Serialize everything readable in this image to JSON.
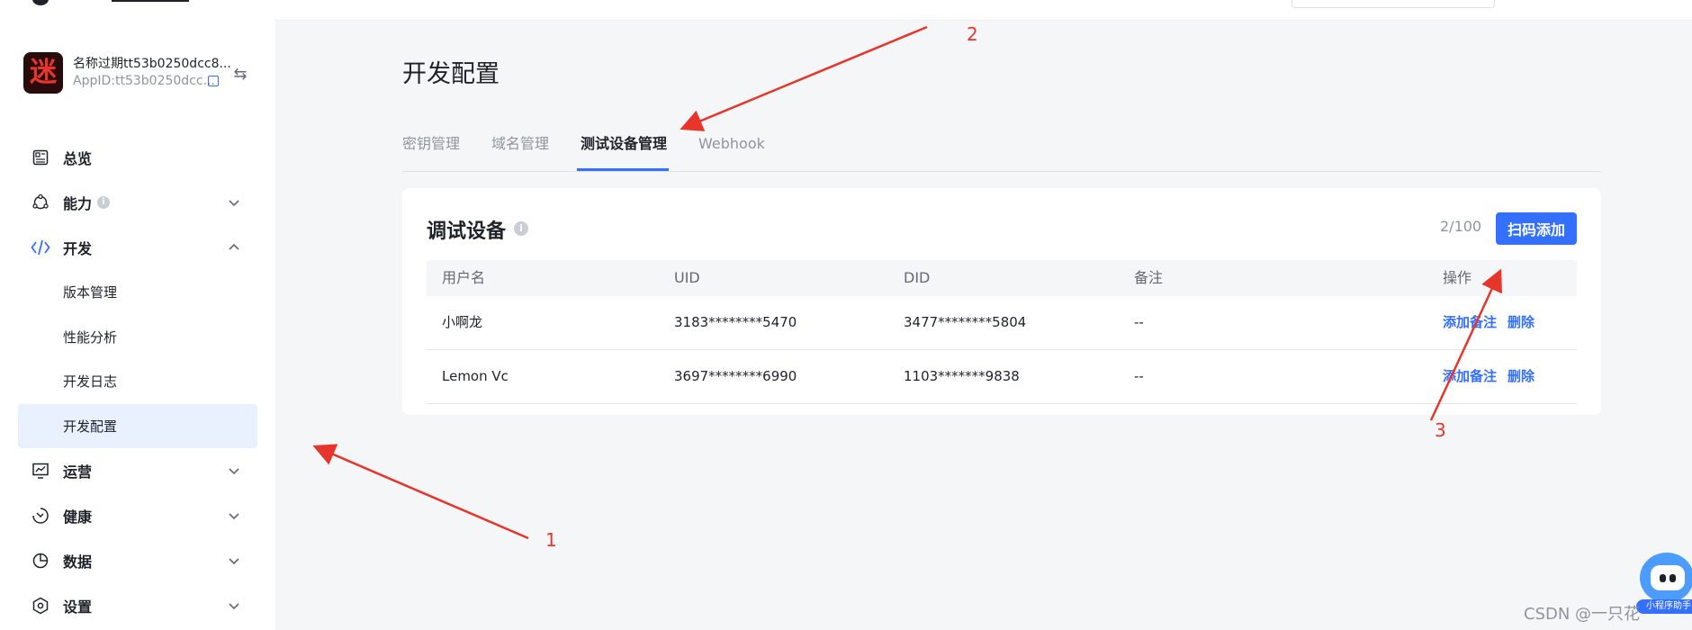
{
  "app": {
    "name": "名称过期tt53b0250dcc8...",
    "app_id": "AppID:tt53b0250dcc...",
    "avatar_glyph": "迷"
  },
  "sidebar": {
    "items": [
      {
        "label": "总览",
        "icon": "overview-icon"
      },
      {
        "label": "能力",
        "icon": "capability-icon",
        "info": "i",
        "expanded": false
      },
      {
        "label": "开发",
        "icon": "code-icon",
        "expanded": true
      },
      {
        "label": "运营",
        "icon": "operation-icon",
        "expanded": false
      },
      {
        "label": "健康",
        "icon": "health-icon",
        "expanded": false
      },
      {
        "label": "数据",
        "icon": "data-icon",
        "expanded": false
      },
      {
        "label": "设置",
        "icon": "settings-icon",
        "expanded": false
      }
    ],
    "dev_sub": [
      "版本管理",
      "性能分析",
      "开发日志",
      "开发配置"
    ],
    "active_sub": "开发配置"
  },
  "page": {
    "title": "开发配置",
    "tabs": [
      "密钥管理",
      "域名管理",
      "测试设备管理",
      "Webhook"
    ],
    "active_tab": "测试设备管理"
  },
  "card": {
    "title": "调试设备",
    "info": "i",
    "count": "2/100",
    "scan_button": "扫码添加",
    "columns": [
      "用户名",
      "UID",
      "DID",
      "备注",
      "操作"
    ],
    "rows": [
      {
        "user": "小啊龙",
        "uid": "3183********5470",
        "did": "3477********5804",
        "note": "--",
        "add_note": "添加备注",
        "delete": "删除"
      },
      {
        "user": "Lemon Vc",
        "uid": "3697********6990",
        "did": "1103*******9838",
        "note": "--",
        "add_note": "添加备注",
        "delete": "删除"
      }
    ]
  },
  "annotations": [
    "1",
    "2",
    "3"
  ],
  "watermark": "CSDN @一只花",
  "assistant_tag": "小程序助手",
  "colors": {
    "accent": "#3370ff",
    "annotation": "#e8352b",
    "active_bg": "#e9f1ff"
  }
}
